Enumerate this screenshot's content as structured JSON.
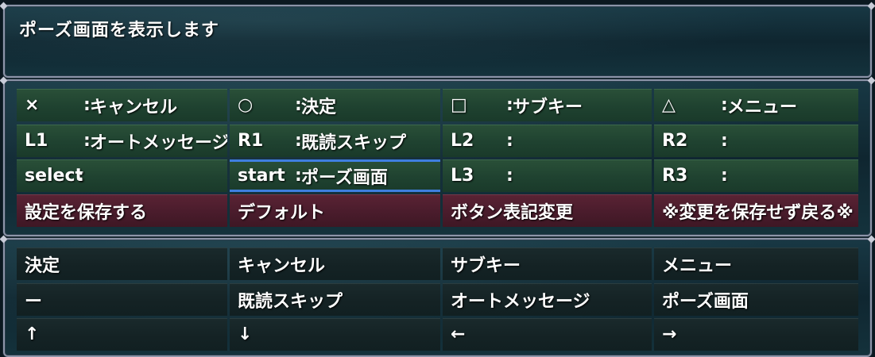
{
  "message": "ポーズ画面を表示します",
  "key_rows": [
    [
      {
        "key": "×",
        "action": "キャンセル"
      },
      {
        "key": "○",
        "action": "決定"
      },
      {
        "key": "□",
        "action": "サブキー"
      },
      {
        "key": "△",
        "action": "メニュー"
      }
    ],
    [
      {
        "key": "L1",
        "action": "オートメッセージ"
      },
      {
        "key": "R1",
        "action": "既読スキップ"
      },
      {
        "key": "L2",
        "action": ""
      },
      {
        "key": "R2",
        "action": ""
      }
    ],
    [
      {
        "key": "select",
        "action": ""
      },
      {
        "key": "start",
        "action": "ポーズ画面"
      },
      {
        "key": "L3",
        "action": ""
      },
      {
        "key": "R3",
        "action": ""
      }
    ]
  ],
  "colon": ":",
  "buttons": [
    "設定を保存する",
    "デフォルト",
    "ボタン表記変更",
    "※変更を保存せず戻る※"
  ],
  "functions": [
    [
      "決定",
      "キャンセル",
      "サブキー",
      "メニュー"
    ],
    [
      "ー",
      "既読スキップ",
      "オートメッセージ",
      "ポーズ画面"
    ],
    [
      "↑",
      "↓",
      "←",
      "→"
    ]
  ]
}
